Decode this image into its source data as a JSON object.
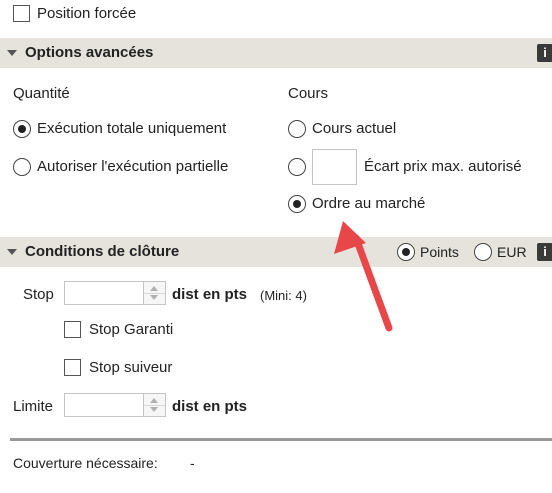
{
  "position_forcee": {
    "label": "Position forcée",
    "checked": false
  },
  "options_avancees": {
    "title": "Options avancées",
    "info_icon": "info-icon",
    "quantite": {
      "heading": "Quantité",
      "options": [
        {
          "label": "Exécution totale uniquement",
          "selected": true
        },
        {
          "label": "Autoriser l'exécution partielle",
          "selected": false
        }
      ]
    },
    "cours": {
      "heading": "Cours",
      "options": [
        {
          "label": "Cours actuel",
          "selected": false
        },
        {
          "label": "Écart prix max. autorisé",
          "selected": false,
          "input_value": ""
        },
        {
          "label": "Ordre au marché",
          "selected": true
        }
      ]
    }
  },
  "conditions_cloture": {
    "title": "Conditions de clôture",
    "info_icon": "info-icon",
    "unit_options": [
      {
        "label": "Points",
        "selected": true
      },
      {
        "label": "EUR",
        "selected": false
      }
    ],
    "stop": {
      "label": "Stop",
      "value": "",
      "unit_label": "dist en pts",
      "hint": "(Mini: 4)"
    },
    "stop_garanti": {
      "label": "Stop Garanti",
      "checked": false
    },
    "stop_suiveur": {
      "label": "Stop suiveur",
      "checked": false
    },
    "limite": {
      "label": "Limite",
      "value": "",
      "unit_label": "dist en pts"
    }
  },
  "couverture": {
    "label": "Couverture nécessaire:",
    "value": "-"
  },
  "annotation": {
    "arrow_color": "#e8474a"
  },
  "colors": {
    "header_bg": "#e6e3dd",
    "text": "#222222",
    "divider": "#999999"
  }
}
